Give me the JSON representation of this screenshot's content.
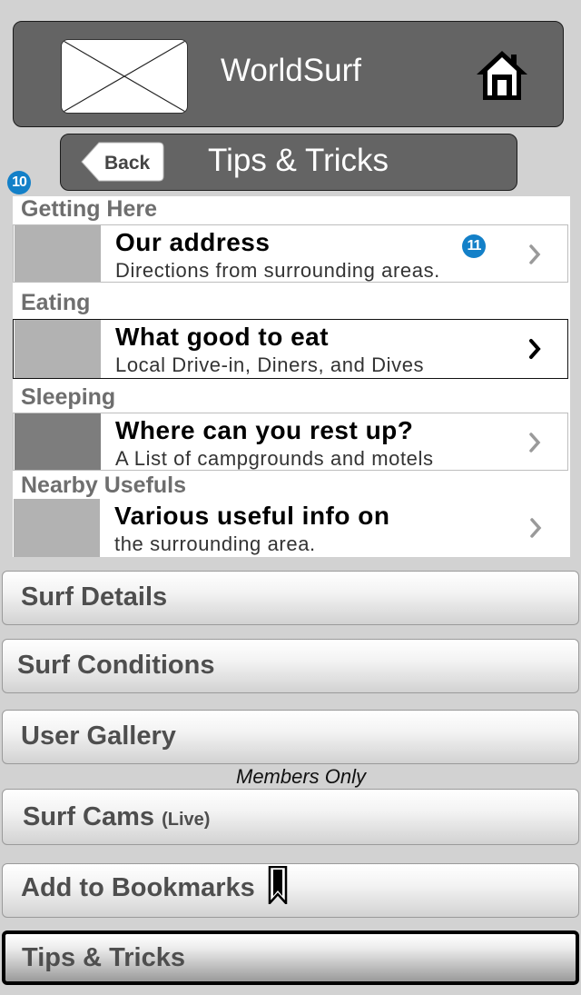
{
  "header": {
    "app_title": "WorldSurf",
    "logo_icon": "image-placeholder-icon",
    "home_icon": "home-icon"
  },
  "subheader": {
    "back_label": "Back",
    "title": "Tips & Tricks"
  },
  "badges": {
    "list_badge": "10",
    "row_badge": "11"
  },
  "sections": [
    {
      "heading": "Getting Here",
      "row": {
        "title": "Our address",
        "subtitle": "Directions from surrounding areas."
      }
    },
    {
      "heading": "Eating",
      "row": {
        "title": "What good to eat",
        "subtitle": "Local Drive-in, Diners, and Dives"
      }
    },
    {
      "heading": "Sleeping",
      "row": {
        "title": "Where can you rest up?",
        "subtitle": "A List of campgrounds and motels"
      }
    },
    {
      "heading": "Nearby Usefuls",
      "row": {
        "title": "Various useful info on",
        "subtitle": "the surrounding area."
      }
    }
  ],
  "menu": {
    "surf_details": "Surf Details",
    "surf_conditions": "Surf Conditions",
    "user_gallery": "User Gallery",
    "members_only": "Members Only",
    "surf_cams": "Surf Cams",
    "surf_cams_note": "(Live)",
    "add_bookmarks": "Add to Bookmarks",
    "tips_tricks": "Tips & Tricks"
  },
  "colors": {
    "header_bg": "#646464",
    "badge": "#1380c8",
    "page_bg": "#d2d2d2"
  }
}
